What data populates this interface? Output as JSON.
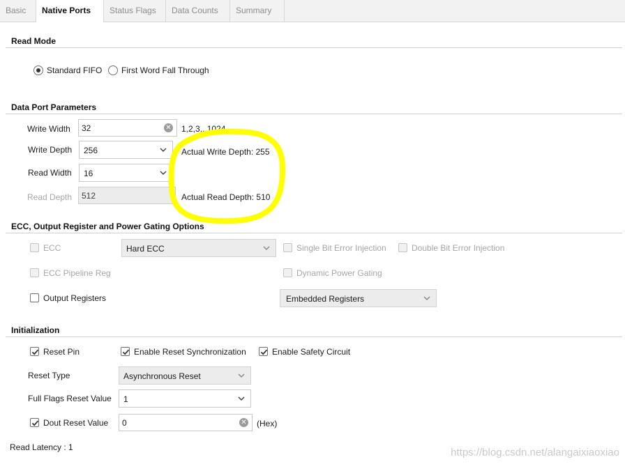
{
  "tabs": [
    "Basic",
    "Native Ports",
    "Status Flags",
    "Data Counts",
    "Summary"
  ],
  "active_tab": "Native Ports",
  "read_mode": {
    "title": "Read Mode",
    "options": [
      "Standard FIFO",
      "First Word Fall Through"
    ],
    "selected": "Standard FIFO"
  },
  "data_port": {
    "title": "Data Port Parameters",
    "write_width_label": "Write Width",
    "write_width_value": "32",
    "write_width_range": "1,2,3,..1024",
    "write_depth_label": "Write Depth",
    "write_depth_value": "256",
    "read_width_label": "Read Width",
    "read_width_value": "16",
    "read_depth_label": "Read Depth",
    "read_depth_value": "512",
    "actual_write_depth": "Actual Write Depth: 255",
    "actual_read_depth": "Actual Read Depth: 510"
  },
  "ecc": {
    "title": "ECC, Output Register and Power Gating Options",
    "ecc_label": "ECC",
    "ecc_type_value": "Hard ECC",
    "single_bit_label": "Single Bit Error Injection",
    "double_bit_label": "Double Bit Error Injection",
    "ecc_pipeline_label": "ECC Pipeline Reg",
    "dynamic_power_label": "Dynamic Power Gating",
    "output_registers_label": "Output Registers",
    "output_registers_type_value": "Embedded Registers"
  },
  "init": {
    "title": "Initialization",
    "reset_pin_label": "Reset Pin",
    "enable_reset_sync_label": "Enable Reset Synchronization",
    "enable_safety_label": "Enable Safety Circuit",
    "reset_type_label": "Reset Type",
    "reset_type_value": "Asynchronous Reset",
    "full_flags_label": "Full Flags Reset Value",
    "full_flags_value": "1",
    "dout_reset_label": "Dout Reset Value",
    "dout_reset_value": "0",
    "dout_reset_unit": "(Hex)"
  },
  "read_latency": "Read Latency : 1",
  "watermark": "https://blog.csdn.net/alangaixiaoxiao",
  "highlight_color": "#ffff00"
}
